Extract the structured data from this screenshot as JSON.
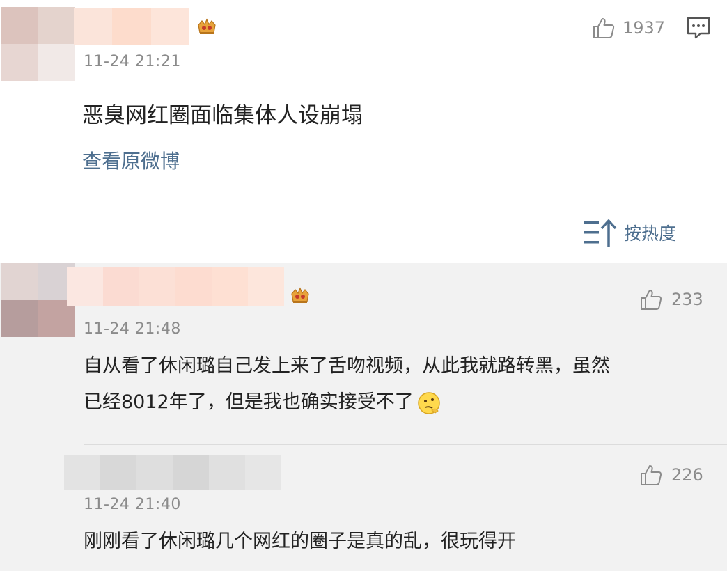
{
  "post": {
    "time": "11-24 21:21",
    "text": "恶臭网红圈面临集体人设崩塌",
    "view_original": "查看原微博",
    "likes": "1937",
    "icons": {
      "like": "thumbs-up-icon",
      "comment": "comment-icon",
      "badge": "crown-badge-icon"
    }
  },
  "sort": {
    "label": "按热度",
    "icon": "sort-up-icon"
  },
  "comments": [
    {
      "time": "11-24 21:48",
      "line1": "自从看了休闲璐自己发上来了舌吻视频，从此我就路转黑，虽然",
      "line2": "已经8012年了，但是我也确实接受不了",
      "likes": "233",
      "emoji": "thinking-emoji-icon"
    },
    {
      "time": "11-24 21:40",
      "line1": "刚刚看了休闲璐几个网红的圈子是真的乱，很玩得开",
      "likes": "226"
    }
  ],
  "colors": {
    "link": "#4e6f8f",
    "meta_text": "#8b8b8b",
    "comments_bg": "#f2f2f2",
    "crown": "#e8a33a"
  }
}
